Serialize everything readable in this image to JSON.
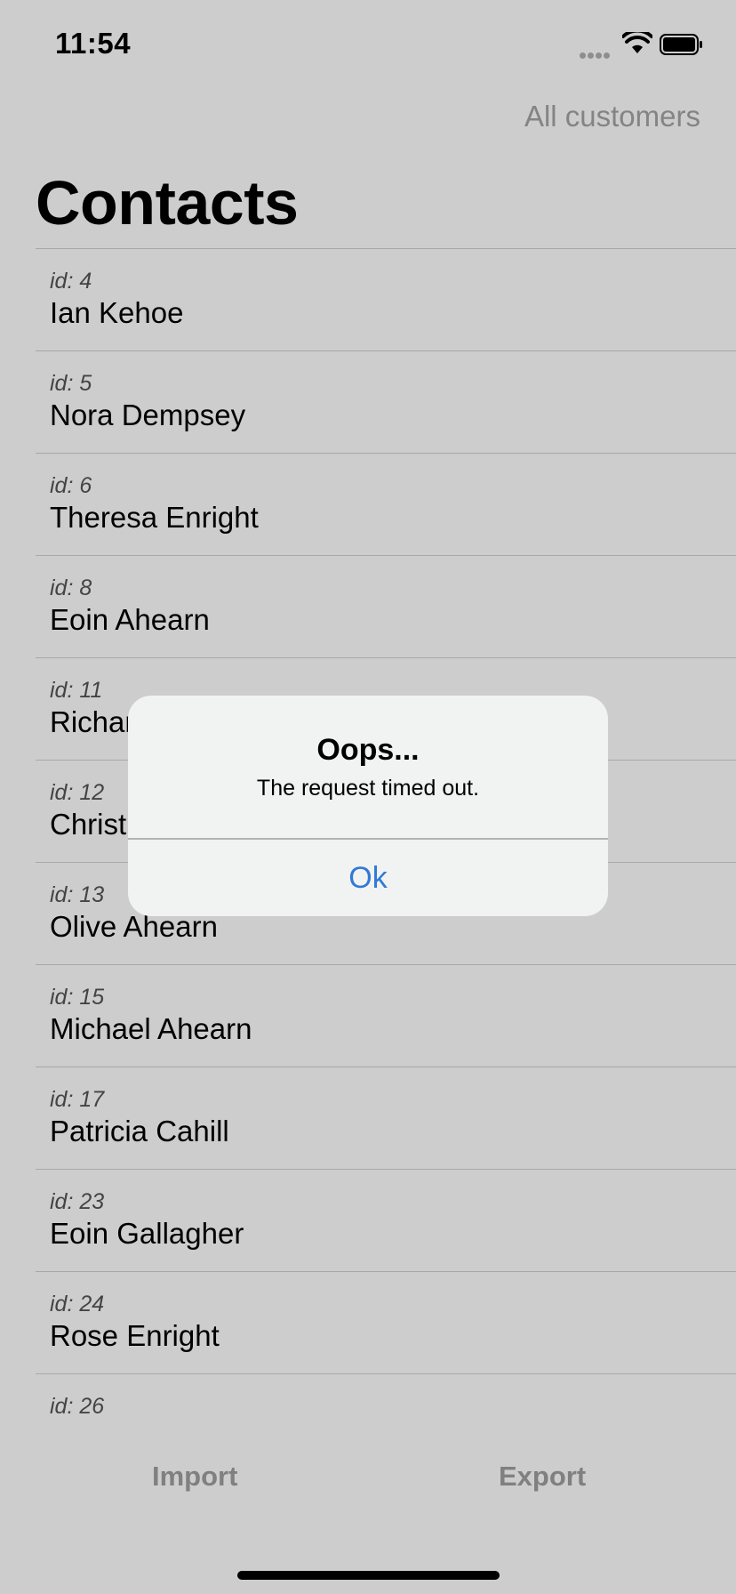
{
  "status_bar": {
    "time": "11:54"
  },
  "nav": {
    "right_button": "All customers",
    "title": "Contacts"
  },
  "contacts": [
    {
      "id": "id: 4",
      "name": "Ian Kehoe"
    },
    {
      "id": "id: 5",
      "name": "Nora Dempsey"
    },
    {
      "id": "id: 6",
      "name": "Theresa Enright"
    },
    {
      "id": "id: 8",
      "name": "Eoin Ahearn"
    },
    {
      "id": "id: 11",
      "name": "Richar"
    },
    {
      "id": "id: 12",
      "name": "Christ"
    },
    {
      "id": "id: 13",
      "name": "Olive Ahearn"
    },
    {
      "id": "id: 15",
      "name": "Michael Ahearn"
    },
    {
      "id": "id: 17",
      "name": "Patricia Cahill"
    },
    {
      "id": "id: 23",
      "name": "Eoin Gallagher"
    },
    {
      "id": "id: 24",
      "name": "Rose Enright"
    },
    {
      "id": "id: 26",
      "name": ""
    }
  ],
  "toolbar": {
    "import_label": "Import",
    "export_label": "Export"
  },
  "alert": {
    "title": "Oops...",
    "message": "The request timed out.",
    "button": "Ok"
  },
  "colors": {
    "background": "#cdcdcd",
    "alert_button": "#2f7ad6",
    "dimmed_text": "#808080"
  }
}
